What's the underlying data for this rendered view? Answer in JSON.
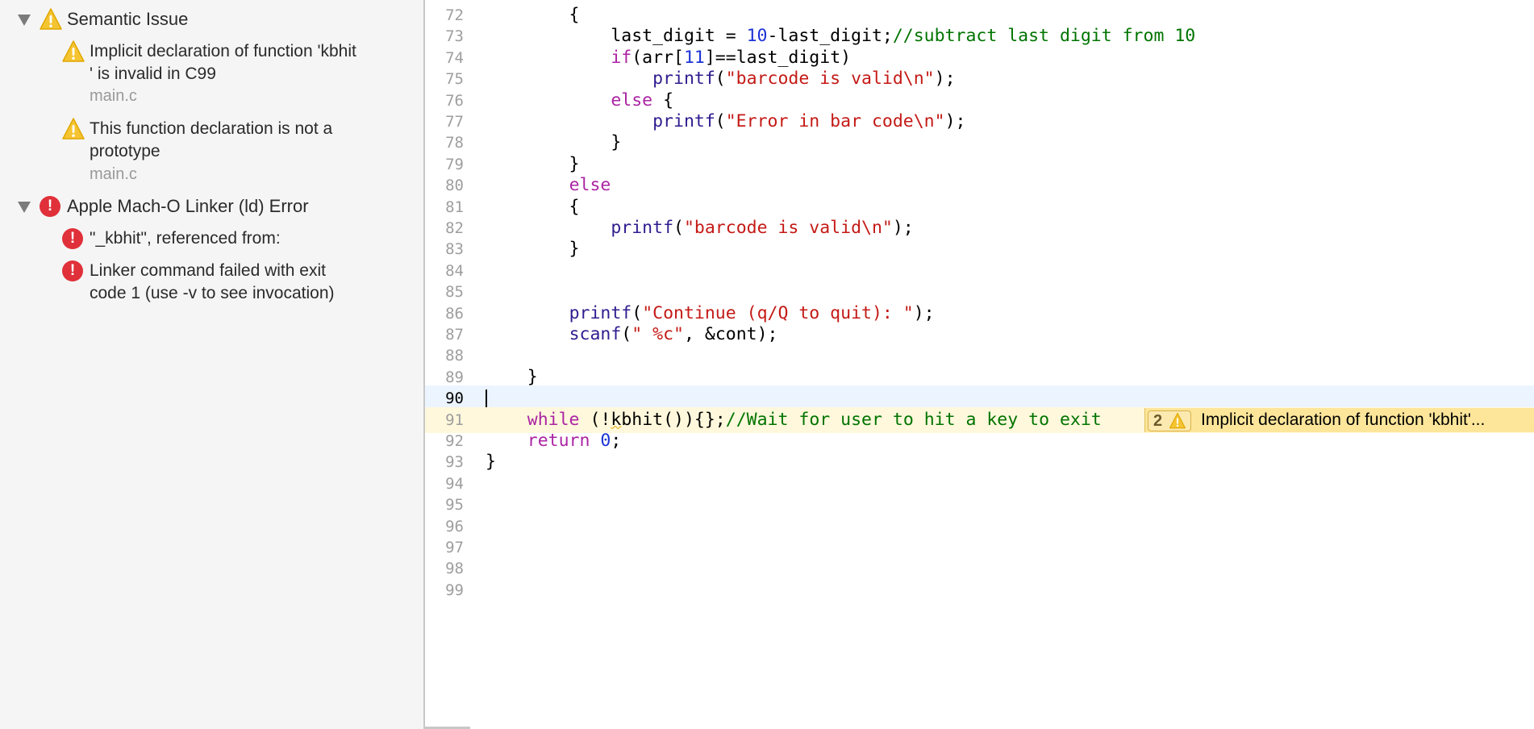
{
  "navigator": {
    "groups": [
      {
        "title": "Semantic Issue",
        "kind": "warning",
        "issues": [
          {
            "line1": "Implicit declaration of function 'kbhit",
            "line2": "' is invalid in C99",
            "file": "main.c"
          },
          {
            "line1": "This function declaration is not a",
            "line2": "prototype",
            "file": "main.c"
          }
        ]
      },
      {
        "title": "Apple Mach-O Linker (ld) Error",
        "kind": "error",
        "issues": [
          {
            "line1": "\"_kbhit\", referenced from:"
          },
          {
            "line1": "Linker command failed with exit",
            "line2": "code 1 (use -v to see invocation)"
          }
        ]
      }
    ]
  },
  "editor": {
    "current_line": 90,
    "warning_line": 91,
    "inline_issue": {
      "count": "2",
      "text": "Implicit declaration of function 'kbhit'..."
    },
    "lines": [
      {
        "n": "72",
        "t": [
          [
            "",
            "        {"
          ]
        ]
      },
      {
        "n": "73",
        "t": [
          [
            "",
            "            last_digit = "
          ],
          [
            "num",
            "10"
          ],
          [
            "",
            "-last_digit;"
          ],
          [
            "cmt",
            "//subtract last digit from 10"
          ]
        ]
      },
      {
        "n": "74",
        "t": [
          [
            "",
            "            "
          ],
          [
            "kw",
            "if"
          ],
          [
            "",
            "(arr["
          ],
          [
            "num",
            "11"
          ],
          [
            "",
            "]==last_digit)"
          ]
        ]
      },
      {
        "n": "75",
        "t": [
          [
            "",
            "                "
          ],
          [
            "fn",
            "printf"
          ],
          [
            "",
            "("
          ],
          [
            "str",
            "\"barcode is valid\\n\""
          ],
          [
            "",
            ");"
          ]
        ]
      },
      {
        "n": "76",
        "t": [
          [
            "",
            "            "
          ],
          [
            "kw",
            "else"
          ],
          [
            "",
            " {"
          ]
        ]
      },
      {
        "n": "77",
        "t": [
          [
            "",
            "                "
          ],
          [
            "fn",
            "printf"
          ],
          [
            "",
            "("
          ],
          [
            "str",
            "\"Error in bar code\\n\""
          ],
          [
            "",
            ");"
          ]
        ]
      },
      {
        "n": "78",
        "t": [
          [
            "",
            "            }"
          ]
        ]
      },
      {
        "n": "79",
        "t": [
          [
            "",
            "        }"
          ]
        ]
      },
      {
        "n": "80",
        "t": [
          [
            "",
            "        "
          ],
          [
            "kw",
            "else"
          ]
        ]
      },
      {
        "n": "81",
        "t": [
          [
            "",
            "        {"
          ]
        ]
      },
      {
        "n": "82",
        "t": [
          [
            "",
            "            "
          ],
          [
            "fn",
            "printf"
          ],
          [
            "",
            "("
          ],
          [
            "str",
            "\"barcode is valid\\n\""
          ],
          [
            "",
            ");"
          ]
        ]
      },
      {
        "n": "83",
        "t": [
          [
            "",
            "        }"
          ]
        ]
      },
      {
        "n": "84",
        "t": []
      },
      {
        "n": "85",
        "t": []
      },
      {
        "n": "86",
        "t": [
          [
            "",
            "        "
          ],
          [
            "fn",
            "printf"
          ],
          [
            "",
            "("
          ],
          [
            "str",
            "\"Continue (q/Q to quit): \""
          ],
          [
            "",
            ");"
          ]
        ]
      },
      {
        "n": "87",
        "t": [
          [
            "",
            "        "
          ],
          [
            "fn",
            "scanf"
          ],
          [
            "",
            "("
          ],
          [
            "str",
            "\" %c\""
          ],
          [
            "",
            ", &cont);"
          ]
        ]
      },
      {
        "n": "88",
        "t": []
      },
      {
        "n": "89",
        "t": [
          [
            "",
            "    }"
          ]
        ]
      },
      {
        "n": "90",
        "t": []
      },
      {
        "n": "91",
        "t": [
          [
            "",
            "    "
          ],
          [
            "kw",
            "while"
          ],
          [
            "",
            " (!"
          ],
          [
            "squig",
            "k"
          ],
          [
            "",
            "bhit()){};"
          ],
          [
            "cmt",
            "//Wait for user to hit a key to exit"
          ]
        ]
      },
      {
        "n": "92",
        "t": [
          [
            "",
            "    "
          ],
          [
            "kw",
            "return"
          ],
          [
            "",
            " "
          ],
          [
            "num",
            "0"
          ],
          [
            "",
            ";"
          ]
        ]
      },
      {
        "n": "93",
        "t": [
          [
            "",
            "}"
          ]
        ]
      },
      {
        "n": "94",
        "t": []
      },
      {
        "n": "95",
        "t": []
      },
      {
        "n": "96",
        "t": []
      },
      {
        "n": "97",
        "t": []
      },
      {
        "n": "98",
        "t": []
      },
      {
        "n": "99",
        "t": []
      }
    ]
  }
}
